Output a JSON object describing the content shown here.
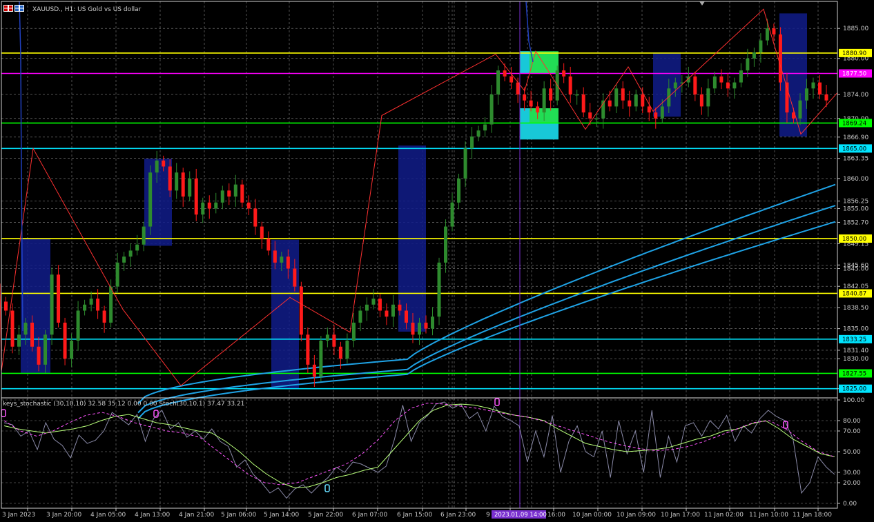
{
  "window": {
    "title": "XAUUSD., H1:  US Gold vs US dollar",
    "icon": "chart-grid-icon"
  },
  "indicator_label": "keys_stochastic (30,10,10) 32.58 35.12 0.00 0.00 Stoch(30,10,1) 37.47 33.21",
  "cursor": {
    "time_label": "2023.01.09 14:00"
  },
  "colors": {
    "background": "#000000",
    "grid": "#c0c0c0",
    "bull": "#2e8b2e",
    "bear": "#ff1a1a",
    "zigzag": "#ff3030",
    "ma": "#1fa3e6",
    "yellow_line": "#ffff00",
    "magenta_line": "#ff00ff",
    "green_line": "#00ff00",
    "cyan_line": "#00e5ff",
    "box": "#101c8a",
    "crosshair": "#7a30d0"
  },
  "chart_data": [
    {
      "type": "candlestick",
      "symbol": "XAUUSD.",
      "timeframe": "H1",
      "description": "US Gold vs US dollar",
      "ylim": [
        1823.7,
        1889.5
      ],
      "price_ticks": [
        "1885.00",
        "1880.00",
        "1874.00",
        "1870.00",
        "1866.90",
        "1863.35",
        "1860.00",
        "1856.25",
        "1855.00",
        "1852.70",
        "1849.15",
        "1845.60",
        "1845.00",
        "1842.05",
        "1838.50",
        "1835.00",
        "1831.40",
        "1830.00",
        "1825.00"
      ],
      "time_ticks": [
        "3 Jan 2023",
        "3 Jan 20:00",
        "4 Jan 05:00",
        "4 Jan 13:00",
        "4 Jan 21:00",
        "5 Jan 06:00",
        "5 Jan 14:00",
        "5 Jan 22:00",
        "6 Jan 07:00",
        "6 Jan 15:00",
        "6 Jan 23:00",
        "9",
        "16:00",
        "10 Jan 00:00",
        "10 Jan 09:00",
        "10 Jan 17:00",
        "11 Jan 02:00",
        "11 Jan 10:00",
        "11 Jan 18:00"
      ],
      "close_path": [
        1838,
        1832,
        1834,
        1836,
        1832,
        1829,
        1834,
        1844,
        1836,
        1830,
        1833,
        1838,
        1839,
        1840,
        1838,
        1836,
        1842,
        1846,
        1847,
        1848,
        1849,
        1852,
        1861,
        1863,
        1862,
        1858,
        1861,
        1857,
        1860,
        1854,
        1856,
        1855,
        1856,
        1858,
        1857,
        1859,
        1856,
        1855,
        1852,
        1850,
        1848,
        1846,
        1847,
        1845,
        1842,
        1834,
        1829,
        1827,
        1833,
        1834,
        1832,
        1830,
        1833,
        1836,
        1838,
        1839,
        1840,
        1838,
        1837,
        1839,
        1838,
        1836,
        1834,
        1836,
        1835,
        1837,
        1846,
        1852,
        1856,
        1860,
        1865,
        1867,
        1868,
        1869,
        1874,
        1878,
        1877,
        1876,
        1874,
        1873,
        1872,
        1871,
        1875,
        1873,
        1878,
        1877,
        1874,
        1874,
        1871,
        1870,
        1870,
        1873,
        1872,
        1875,
        1873,
        1872,
        1874,
        1872,
        1871,
        1870,
        1872,
        1875,
        1876,
        1876,
        1877,
        1874,
        1872,
        1875,
        1877,
        1876,
        1875,
        1876,
        1878,
        1880,
        1881,
        1883,
        1885,
        1884,
        1876,
        1871,
        1870,
        1873,
        1875,
        1876,
        1874,
        1873
      ],
      "horizontal_levels": [
        {
          "price": 1880.9,
          "label": "1880.90",
          "color": "yellow"
        },
        {
          "price": 1877.5,
          "label": "1877.50",
          "color": "magenta"
        },
        {
          "price": 1869.24,
          "label": "1869.24",
          "color": "green"
        },
        {
          "price": 1865.0,
          "label": "1865.00",
          "color": "cyan"
        },
        {
          "price": 1850.0,
          "label": "1850.00",
          "color": "yellow"
        },
        {
          "price": 1840.87,
          "label": "1840.87",
          "color": "yellow"
        },
        {
          "price": 1833.25,
          "label": "1833.25",
          "color": "cyan"
        },
        {
          "price": 1827.55,
          "label": "1827.55",
          "color": "green"
        },
        {
          "price": 1825.0,
          "label": "1825.00",
          "color": "cyan"
        }
      ],
      "zigzag": [
        1842.5,
        1827.9,
        1865.0,
        1838.2,
        1825.5,
        1840.2,
        1834.4,
        1870.5,
        1880.7,
        1874.6,
        1881.2,
        1868.2,
        1878.6,
        1871.2,
        1888.2,
        1867.4,
        1874.3
      ],
      "moving_averages": [
        {
          "start": 1822.5,
          "mid": 1829.9,
          "end": 1859.0
        },
        {
          "start": 1821.0,
          "mid": 1828.2,
          "end": 1855.5
        },
        {
          "start": 1820.0,
          "mid": 1827.4,
          "end": 1852.8
        }
      ]
    },
    {
      "type": "line",
      "name": "keys_stochastic (30,10,10) / Stoch(30,10,1)",
      "ylim": [
        0,
        100
      ],
      "value_ticks": [
        "100.00",
        "80.00",
        "70.00",
        "50.00",
        "30.00",
        "20.00",
        "0.00"
      ],
      "series": [
        {
          "values": [
            78,
            76,
            65,
            70,
            52,
            78,
            62,
            56,
            44,
            66,
            58,
            61,
            70,
            88,
            82,
            76,
            86,
            60,
            82,
            90,
            72,
            78,
            64,
            70,
            62,
            72,
            60,
            55,
            35,
            42,
            28,
            20,
            10,
            15,
            5,
            14,
            18,
            10,
            18,
            25,
            35,
            30,
            40,
            38,
            34,
            30,
            36,
            62,
            95,
            60,
            78,
            85,
            96,
            98,
            92,
            96,
            82,
            88,
            70,
            94,
            84,
            80,
            75,
            40,
            70,
            45,
            85,
            30,
            60,
            75,
            50,
            45,
            70,
            25,
            80,
            48,
            70,
            30,
            90,
            25,
            65,
            40,
            75,
            78,
            65,
            80,
            72,
            85,
            60,
            75,
            68,
            82,
            90,
            84,
            80,
            62,
            10,
            20,
            45,
            35,
            28
          ]
        },
        {
          "values": [
            75,
            72,
            70,
            68,
            70,
            72,
            75,
            80,
            84,
            86,
            82,
            78,
            76,
            73,
            70,
            68,
            60,
            50,
            38,
            28,
            20,
            15,
            16,
            20,
            25,
            28,
            32,
            35,
            50,
            65,
            80,
            90,
            95,
            96,
            95,
            92,
            88,
            85,
            83,
            80,
            72,
            65,
            58,
            55,
            52,
            50,
            51,
            52,
            54,
            58,
            62,
            65,
            70,
            72,
            77,
            80,
            72,
            62,
            55,
            48,
            45
          ]
        },
        {
          "values": [
            80,
            70,
            65,
            70,
            78,
            85,
            88,
            84,
            78,
            74,
            70,
            68,
            64,
            52,
            40,
            28,
            20,
            18,
            20,
            26,
            32,
            38,
            48,
            62,
            80,
            92,
            97,
            96,
            94,
            92,
            89,
            86,
            84,
            80,
            75,
            70,
            65,
            60,
            56,
            53,
            51,
            52,
            55,
            60,
            66,
            72,
            78,
            80,
            72,
            60,
            50,
            45
          ]
        }
      ]
    }
  ]
}
